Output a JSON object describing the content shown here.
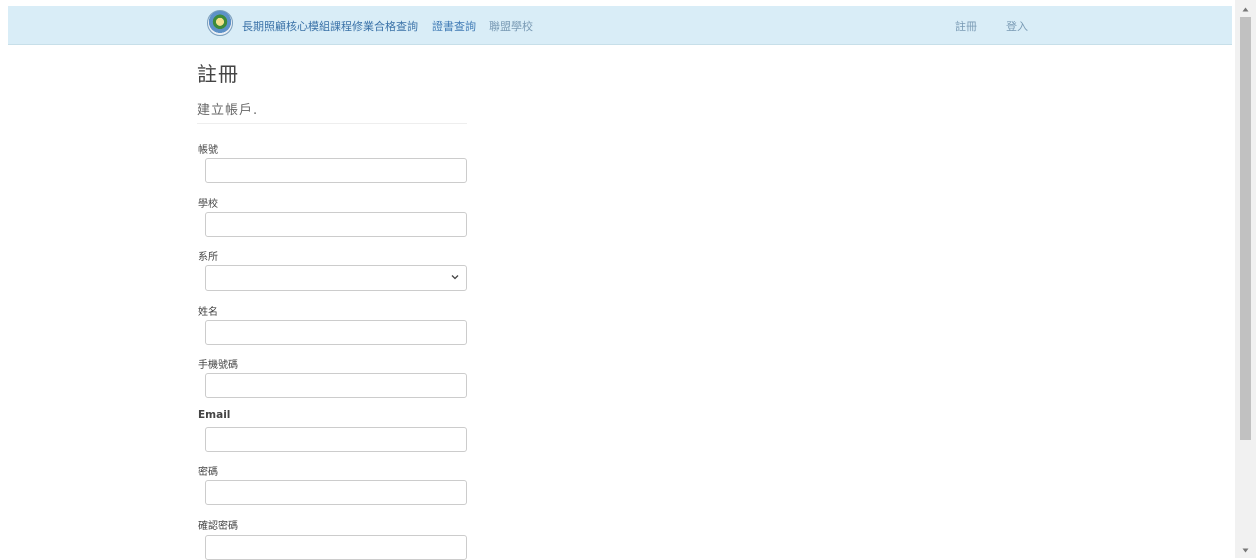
{
  "navbar": {
    "brand": "長期照顧核心模組課程修業合格查詢",
    "links": [
      "證書查詢",
      "聯盟學校"
    ],
    "right_links": [
      "註冊",
      "登入"
    ]
  },
  "page": {
    "title": "註冊",
    "subtitle": "建立帳戶."
  },
  "form": {
    "account_label": "帳號",
    "account_value": "",
    "school_label": "學校",
    "school_value": "",
    "department_label": "系所",
    "department_selected": "",
    "name_label": "姓名",
    "name_value": "",
    "phone_label": "手機號碼",
    "phone_value": "",
    "email_label": "Email",
    "email_value": "",
    "password_label": "密碼",
    "password_value": "",
    "confirm_password_label": "確認密碼",
    "confirm_password_value": ""
  },
  "icons": {
    "logo": "emblem-logo-icon",
    "select_arrow": "chevron-down-icon",
    "scroll_up": "scroll-up-arrow-icon",
    "scroll_down": "scroll-down-arrow-icon"
  },
  "colors": {
    "navbar_bg": "#d9edf7",
    "link": "#3f7ab5"
  }
}
